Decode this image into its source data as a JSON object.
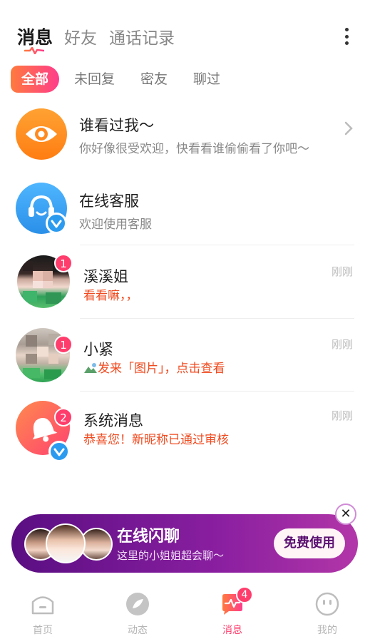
{
  "header": {
    "tabs": [
      {
        "label": "消息",
        "active": true
      },
      {
        "label": "好友",
        "active": false
      },
      {
        "label": "通话记录",
        "active": false
      }
    ],
    "more_icon": "more-vertical-icon"
  },
  "filters": [
    {
      "label": "全部",
      "active": true
    },
    {
      "label": "未回复",
      "active": false
    },
    {
      "label": "密友",
      "active": false
    },
    {
      "label": "聊过",
      "active": false
    }
  ],
  "conversations": [
    {
      "name": "谁看过我～",
      "preview": "你好像很受欢迎，快看看谁偷偷看了你吧～",
      "icon": "eye-icon",
      "color": "#ff8a1f"
    },
    {
      "name": "在线客服",
      "preview": "欢迎使用客服",
      "icon": "headset-icon",
      "color": "#2e9cf3",
      "verified": true
    },
    {
      "name": "溪溪姐",
      "preview": "看看嘛，，",
      "time": "刚刚",
      "unread": "1"
    },
    {
      "name": "小紧",
      "preview": "发来「图片」，点击查看",
      "time": "刚刚",
      "unread": "1",
      "preview_icon": "image-icon"
    },
    {
      "name": "系统消息",
      "preview": "恭喜您！新昵称已通过审核",
      "time": "刚刚",
      "unread": "2",
      "icon": "bell-icon",
      "color": "#ff5a4e",
      "verified": true
    }
  ],
  "promo": {
    "title": "在线闪聊",
    "subtitle": "这里的小姐姐超会聊～",
    "button": "免费使用",
    "close_icon": "close-icon"
  },
  "bottom_nav": [
    {
      "label": "首页",
      "icon": "home-icon"
    },
    {
      "label": "动态",
      "icon": "compass-icon"
    },
    {
      "label": "消息",
      "icon": "message-icon",
      "active": true,
      "badge": "4"
    },
    {
      "label": "我的",
      "icon": "profile-icon"
    }
  ],
  "colors": {
    "accent": "#ff3d6c",
    "orange": "#ef4a1f",
    "purple": "#6b1589"
  }
}
